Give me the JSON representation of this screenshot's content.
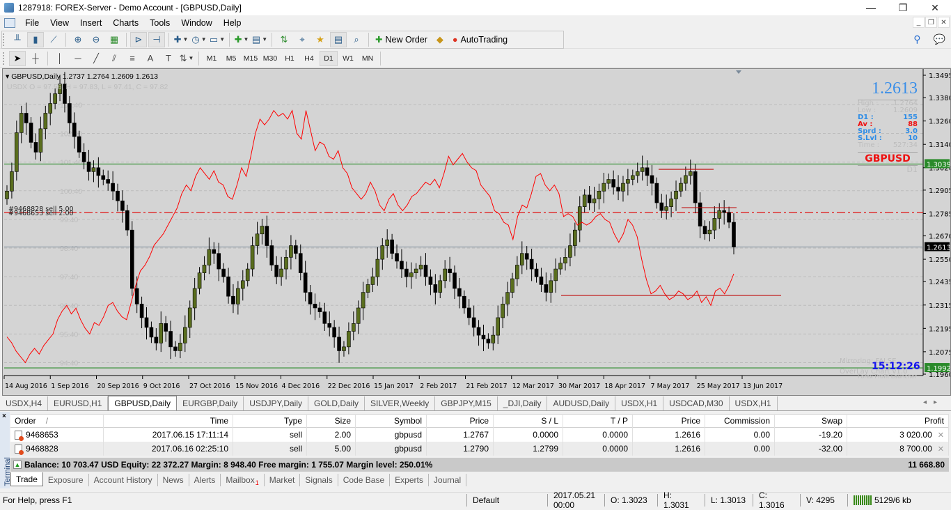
{
  "window": {
    "title": "1287918: FOREX-Server - Demo Account - [GBPUSD,Daily]",
    "controls": {
      "minimize": "—",
      "restore": "❐",
      "close": "✕"
    }
  },
  "menu": [
    "File",
    "View",
    "Insert",
    "Charts",
    "Tools",
    "Window",
    "Help"
  ],
  "toolbar": {
    "new_order_label": "New Order",
    "autotrading_label": "AutoTrading",
    "timeframes": [
      "M1",
      "M5",
      "M15",
      "M30",
      "H1",
      "H4",
      "D1",
      "W1",
      "MN"
    ],
    "active_timeframe": "D1"
  },
  "chart": {
    "header": "GBPUSD,Daily  1.2737 1.2764 1.2609 1.2613",
    "overlay_info": "USDX O = 97.56, H = 97.83, L = 97.41, C = 97.82",
    "order_labels": [
      "#9468828 sell 5.00",
      "#9468653 sell 2.00"
    ],
    "usdx_levels": [
      "103.40",
      "102.40",
      "101.40",
      "100.40",
      "99.40",
      "98.40",
      "97.40",
      "96.40",
      "95.40",
      "94.40"
    ],
    "info_panel": {
      "price": "1.2613",
      "high": {
        "label": "High :",
        "value": "1.2764"
      },
      "low": {
        "label": "Low :",
        "value": "1.2609"
      },
      "d1": {
        "label": "D1 :",
        "value": "155"
      },
      "av": {
        "label": "Av :",
        "value": "88"
      },
      "sprd": {
        "label": "Sprd :",
        "value": "3.0"
      },
      "slvl": {
        "label": "S.Lvl :",
        "value": "10"
      },
      "time": {
        "label": "Time :",
        "value": "527:34"
      },
      "symbol": "GBPUSD",
      "tf": "D1"
    },
    "clock": "15:12:26",
    "mirroring": "Mirroring: FALSE",
    "overlay_name": "OverLay Chart v1.0",
    "launcher": "Forex Profit Launcher",
    "colors": {
      "bg": "#d4d4d4",
      "bull": "#5a6e1e",
      "bear": "#000000",
      "usdx_line": "#ff0000",
      "green_level": "#2a8a2a",
      "order_line": "#e01010"
    }
  },
  "chart_data": {
    "type": "candlestick",
    "title": "GBPUSD,Daily",
    "y_ticks": [
      "1.3495",
      "1.3380",
      "1.3260",
      "1.3140",
      "1.3020",
      "1.2905",
      "1.2785",
      "1.2670",
      "1.2550",
      "1.2435",
      "1.2315",
      "1.2195",
      "1.2075",
      "1.1960"
    ],
    "ylim": [
      1.196,
      1.352
    ],
    "x_ticks": [
      "14 Aug 2016",
      "1 Sep 2016",
      "20 Sep 2016",
      "9 Oct 2016",
      "27 Oct 2016",
      "15 Nov 2016",
      "4 Dec 2016",
      "22 Dec 2016",
      "15 Jan 2017",
      "2 Feb 2017",
      "21 Feb 2017",
      "12 Mar 2017",
      "30 Mar 2017",
      "18 Apr 2017",
      "7 May 2017",
      "25 May 2017",
      "13 Jun 2017"
    ],
    "price_labels": [
      {
        "value": "1.3039",
        "style": "green"
      },
      {
        "value": "1.2613",
        "style": "black"
      },
      {
        "value": "1.1992",
        "style": "green"
      }
    ],
    "levels": {
      "green_upper": 1.3039,
      "green_lower": 1.1992,
      "current": 1.2613,
      "sell_orders": 1.279
    },
    "close_path": [
      1.29,
      1.3,
      1.32,
      1.33,
      1.325,
      1.315,
      1.31,
      1.322,
      1.33,
      1.335,
      1.34,
      1.345,
      1.335,
      1.325,
      1.318,
      1.31,
      1.305,
      1.3,
      1.302,
      1.298,
      1.296,
      1.294,
      1.29,
      1.285,
      1.28,
      1.27,
      1.24,
      1.232,
      1.225,
      1.22,
      1.215,
      1.212,
      1.222,
      1.218,
      1.21,
      1.208,
      1.212,
      1.22,
      1.23,
      1.24,
      1.248,
      1.252,
      1.26,
      1.258,
      1.25,
      1.246,
      1.236,
      1.232,
      1.24,
      1.244,
      1.25,
      1.262,
      1.268,
      1.272,
      1.262,
      1.252,
      1.246,
      1.25,
      1.256,
      1.262,
      1.258,
      1.248,
      1.238,
      1.232,
      1.23,
      1.228,
      1.222,
      1.22,
      1.215,
      1.208,
      1.21,
      1.218,
      1.222,
      1.23,
      1.238,
      1.242,
      1.246,
      1.255,
      1.262,
      1.265,
      1.258,
      1.254,
      1.25,
      1.246,
      1.248,
      1.25,
      1.252,
      1.246,
      1.242,
      1.238,
      1.244,
      1.25,
      1.248,
      1.24,
      1.236,
      1.23,
      1.225,
      1.22,
      1.216,
      1.214,
      1.212,
      1.216,
      1.225,
      1.232,
      1.238,
      1.245,
      1.252,
      1.258,
      1.255,
      1.25,
      1.246,
      1.242,
      1.238,
      1.244,
      1.25,
      1.253,
      1.256,
      1.262,
      1.27,
      1.282,
      1.288,
      1.284,
      1.286,
      1.29,
      1.294,
      1.296,
      1.292,
      1.29,
      1.294,
      1.296,
      1.298,
      1.3,
      1.302,
      1.298,
      1.294,
      1.284,
      1.28,
      1.282,
      1.286,
      1.29,
      1.294,
      1.298,
      1.3,
      1.284,
      1.272,
      1.268,
      1.27,
      1.276,
      1.28,
      1.279,
      1.274,
      1.2613
    ],
    "usdx_path": [
      95.3,
      95.1,
      94.8,
      94.6,
      94.4,
      94.7,
      94.9,
      94.7,
      95.0,
      95.2,
      95.4,
      95.9,
      96.2,
      96.4,
      96.1,
      96.3,
      95.9,
      95.6,
      95.4,
      95.8,
      95.7,
      96.0,
      96.4,
      96.5,
      96.2,
      96.0,
      95.9,
      96.5,
      97.1,
      97.6,
      97.8,
      98.1,
      98.5,
      98.7,
      98.9,
      99.2,
      99.5,
      99.8,
      100.3,
      100.6,
      100.4,
      100.9,
      101.2,
      101.0,
      100.8,
      101.1,
      100.7,
      100.6,
      100.2,
      100.1,
      100.6,
      101.2,
      100.9,
      101.6,
      102.4,
      102.9,
      102.7,
      102.9,
      103.2,
      103.0,
      103.1,
      102.9,
      103.2,
      102.4,
      102.2,
      103.2,
      102.5,
      101.8,
      102.1,
      102.0,
      101.6,
      101.5,
      101.8,
      101.2,
      101.0,
      100.5,
      100.3,
      100.1,
      100.3,
      100.7,
      100.4,
      99.9,
      99.7,
      100.1,
      100.3,
      99.9,
      99.7,
      99.9,
      100.2,
      100.3,
      100.5,
      100.7,
      100.6,
      100.8,
      100.5,
      101.0,
      101.6,
      101.3,
      101.5,
      101.7,
      101.4,
      101.2,
      101.1,
      100.6,
      100.4,
      100.2,
      99.7,
      99.6,
      99.3,
      99.2,
      98.7,
      99.5,
      99.9,
      99.8,
      100.3,
      100.9,
      101.0,
      100.6,
      100.4,
      100.6,
      100.3,
      99.5,
      99.6,
      99.5,
      99.2,
      99.3,
      99.2,
      99.3,
      99.5,
      99.6,
      99.4,
      99.3,
      98.9,
      98.6,
      98.9,
      99.4,
      99.2,
      98.8,
      98.0,
      97.3,
      96.8,
      96.9,
      97.1,
      96.8,
      96.6,
      96.7,
      96.9,
      96.8,
      96.6,
      96.7,
      96.9,
      96.5,
      96.7,
      96.4,
      96.9,
      97.0,
      96.8,
      97.1,
      97.5
    ]
  },
  "chart_tabs": [
    "USDX,H4",
    "EURUSD,H1",
    "GBPUSD,Daily",
    "EURGBP,Daily",
    "USDJPY,Daily",
    "GOLD,Daily",
    "SILVER,Weekly",
    "GBPJPY,M15",
    "_DJI,Daily",
    "AUDUSD,Daily",
    "USDX,H1",
    "USDCAD,M30",
    "USDX,H1"
  ],
  "active_chart_tab": "GBPUSD,Daily",
  "terminal": {
    "side_label": "Terminal",
    "columns": [
      "Order",
      "Time",
      "Type",
      "Size",
      "Symbol",
      "Price",
      "S / L",
      "T / P",
      "Price",
      "Commission",
      "Swap",
      "Profit"
    ],
    "sort_indicator": "/",
    "orders": [
      {
        "order": "9468653",
        "time": "2017.06.15 17:11:14",
        "type": "sell",
        "size": "2.00",
        "symbol": "gbpusd",
        "price": "1.2767",
        "sl": "0.0000",
        "tp": "0.0000",
        "cur_price": "1.2616",
        "commission": "0.00",
        "swap": "-19.20",
        "profit": "3 020.00"
      },
      {
        "order": "9468828",
        "time": "2017.06.16 02:25:10",
        "type": "sell",
        "size": "5.00",
        "symbol": "gbpusd",
        "price": "1.2790",
        "sl": "1.2799",
        "tp": "0.0000",
        "cur_price": "1.2616",
        "commission": "0.00",
        "swap": "-32.00",
        "profit": "8 700.00"
      }
    ],
    "balance_line": "Balance: 10 703.47 USD  Equity: 22 372.27  Margin: 8 948.40  Free margin: 1 755.07  Margin level: 250.01%",
    "total_profit": "11 668.80",
    "tabs": [
      "Trade",
      "Exposure",
      "Account History",
      "News",
      "Alerts",
      "Mailbox",
      "Market",
      "Signals",
      "Code Base",
      "Experts",
      "Journal"
    ],
    "active_tab": "Trade",
    "mailbox_badge": "1"
  },
  "status": {
    "help": "For Help, press F1",
    "profile": "Default",
    "datetime": "2017.05.21 00:00",
    "open": "O: 1.3023",
    "high": "H: 1.3031",
    "low": "L: 1.3013",
    "close": "C: 1.3016",
    "volume": "V: 4295",
    "traffic": "5129/6 kb"
  }
}
